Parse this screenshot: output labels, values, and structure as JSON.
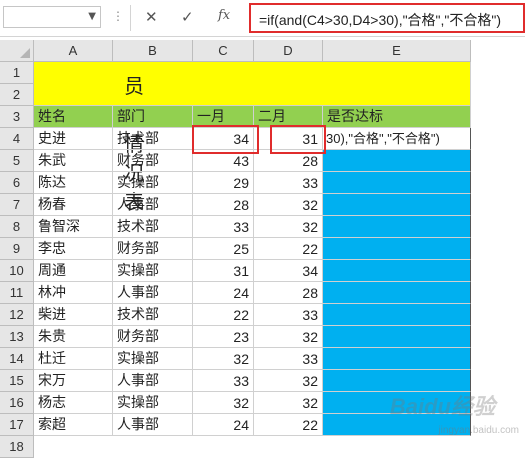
{
  "formula_bar": {
    "name_box_value": "",
    "cancel_icon": "close-icon",
    "enter_icon": "check-icon",
    "fx_label": "fx",
    "formula": "=if(and(C4>30,D4>30),\"合格\",\"不合格\")"
  },
  "columns": [
    "A",
    "B",
    "C",
    "D",
    "E"
  ],
  "row_numbers": [
    "1",
    "2",
    "3",
    "4",
    "5",
    "6",
    "7",
    "8",
    "9",
    "10",
    "11",
    "12",
    "13",
    "14",
    "15",
    "16",
    "17",
    "18"
  ],
  "sheet": {
    "title": "员工情况表",
    "headers": {
      "name": "姓名",
      "dept": "部门",
      "jan": "一月",
      "feb": "二月",
      "status": "是否达标"
    },
    "rows": [
      {
        "name": "史进",
        "dept": "技术部",
        "jan": "34",
        "feb": "31"
      },
      {
        "name": "朱武",
        "dept": "财务部",
        "jan": "43",
        "feb": "28"
      },
      {
        "name": "陈达",
        "dept": "实操部",
        "jan": "29",
        "feb": "33"
      },
      {
        "name": "杨春",
        "dept": "人事部",
        "jan": "28",
        "feb": "32"
      },
      {
        "name": "鲁智深",
        "dept": "技术部",
        "jan": "33",
        "feb": "32"
      },
      {
        "name": "李忠",
        "dept": "财务部",
        "jan": "25",
        "feb": "22"
      },
      {
        "name": "周通",
        "dept": "实操部",
        "jan": "31",
        "feb": "34"
      },
      {
        "name": "林冲",
        "dept": "人事部",
        "jan": "24",
        "feb": "28"
      },
      {
        "name": "柴进",
        "dept": "技术部",
        "jan": "22",
        "feb": "33"
      },
      {
        "name": "朱贵",
        "dept": "财务部",
        "jan": "23",
        "feb": "32"
      },
      {
        "name": "杜迁",
        "dept": "实操部",
        "jan": "32",
        "feb": "33"
      },
      {
        "name": "宋万",
        "dept": "人事部",
        "jan": "33",
        "feb": "32"
      },
      {
        "name": "杨志",
        "dept": "实操部",
        "jan": "32",
        "feb": "32"
      },
      {
        "name": "索超",
        "dept": "人事部",
        "jan": "24",
        "feb": "22"
      }
    ],
    "e4_overflow_text": "30),\"合格\",\"不合格\")"
  },
  "watermark": {
    "brand": "Baidu经验",
    "url": "jingyan.baidu.com"
  },
  "colors": {
    "title_fill": "#ffff00",
    "header_fill": "#92d050",
    "status_fill": "#00b0f0",
    "highlight": "#e02c2c"
  }
}
